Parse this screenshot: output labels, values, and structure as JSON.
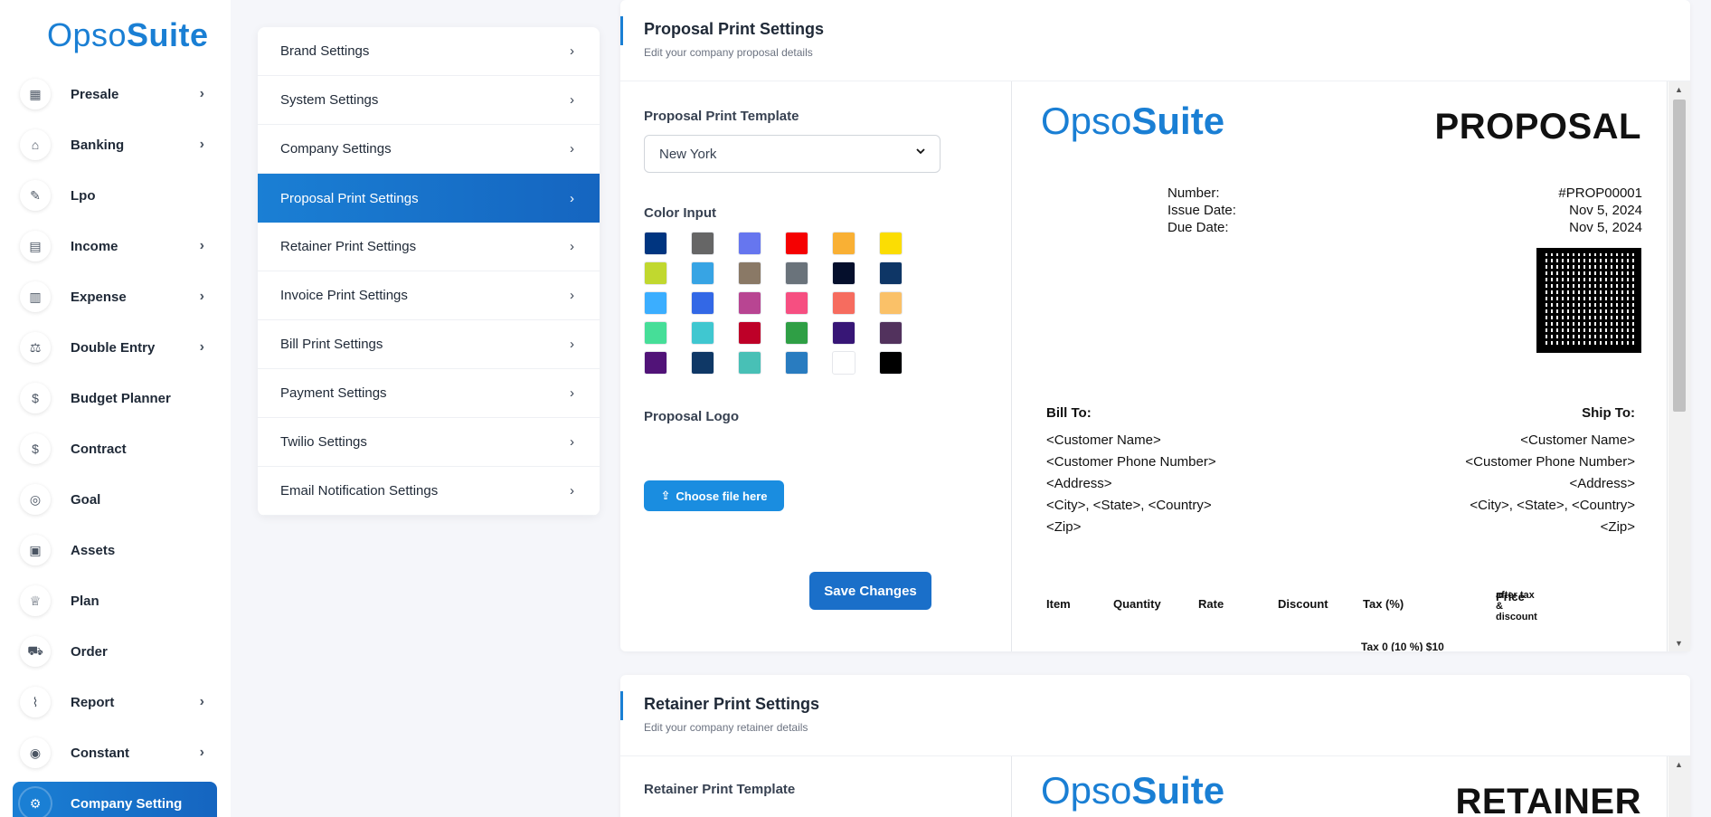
{
  "logo": {
    "prefix": "Opso",
    "suite": "Suite"
  },
  "nav": {
    "items": [
      {
        "label": "Presale",
        "icon": "building-icon",
        "glyph": "▦",
        "chevron": true
      },
      {
        "label": "Banking",
        "icon": "bank-icon",
        "glyph": "⌂",
        "chevron": true
      },
      {
        "label": "Lpo",
        "icon": "note-icon",
        "glyph": "✎",
        "chevron": false
      },
      {
        "label": "Income",
        "icon": "document-icon",
        "glyph": "▤",
        "chevron": true
      },
      {
        "label": "Expense",
        "icon": "receipt-icon",
        "glyph": "▥",
        "chevron": true
      },
      {
        "label": "Double Entry",
        "icon": "scale-icon",
        "glyph": "⚖",
        "chevron": true
      },
      {
        "label": "Budget Planner",
        "icon": "money-stack-icon",
        "glyph": "$",
        "chevron": false
      },
      {
        "label": "Contract",
        "icon": "coin-stack-icon",
        "glyph": "$",
        "chevron": false
      },
      {
        "label": "Goal",
        "icon": "target-icon",
        "glyph": "◎",
        "chevron": false
      },
      {
        "label": "Assets",
        "icon": "calculator-icon",
        "glyph": "▣",
        "chevron": false
      },
      {
        "label": "Plan",
        "icon": "trophy-icon",
        "glyph": "♕",
        "chevron": false
      },
      {
        "label": "Order",
        "icon": "cart-icon",
        "glyph": "⛟",
        "chevron": false
      },
      {
        "label": "Report",
        "icon": "chart-icon",
        "glyph": "⌇",
        "chevron": true
      },
      {
        "label": "Constant",
        "icon": "spiral-icon",
        "glyph": "◉",
        "chevron": true
      },
      {
        "label": "Company Setting",
        "icon": "settings-icon",
        "glyph": "⚙",
        "chevron": false,
        "active": true
      }
    ]
  },
  "settings_menu": [
    {
      "label": "Brand Settings"
    },
    {
      "label": "System Settings"
    },
    {
      "label": "Company Settings"
    },
    {
      "label": "Proposal Print Settings",
      "active": true
    },
    {
      "label": "Retainer Print Settings"
    },
    {
      "label": "Invoice Print Settings"
    },
    {
      "label": "Bill Print Settings"
    },
    {
      "label": "Payment Settings"
    },
    {
      "label": "Twilio Settings"
    },
    {
      "label": "Email Notification Settings"
    }
  ],
  "proposal": {
    "title": "Proposal Print Settings",
    "subtitle": "Edit your company proposal details",
    "template_label": "Proposal Print Template",
    "template_value": "New York",
    "color_label": "Color Input",
    "logo_label": "Proposal Logo",
    "upload_label": "Choose file here",
    "save_label": "Save Changes",
    "colors": [
      "#003580",
      "#666666",
      "#6676ef",
      "#f50102",
      "#f9b034",
      "#fbdd03",
      "#c1d82f",
      "#37a4e4",
      "#8a7966",
      "#6a737b",
      "#050f2c",
      "#0e3666",
      "#3baeff",
      "#3368e6",
      "#b84592",
      "#f64f81",
      "#f66c5f",
      "#fac168",
      "#46de98",
      "#40c7d0",
      "#be0028",
      "#2f9f45",
      "#371676",
      "#52325d",
      "#511378",
      "#0f3866",
      "#48c0b6",
      "#297cc0",
      "#ffffff",
      "#000000"
    ],
    "preview": {
      "heading": "PROPOSAL",
      "number_label": "Number:",
      "number": "#PROP00001",
      "issue_label": "Issue Date:",
      "issue": "Nov 5, 2024",
      "due_label": "Due Date:",
      "due": "Nov 5, 2024",
      "bill_to": "Bill To:",
      "ship_to": "Ship To:",
      "address": [
        "<Customer Name>",
        "<Customer Phone Number>",
        "<Address>",
        "<City>, <State>, <Country>",
        "<Zip>"
      ],
      "cols": {
        "item": "Item",
        "qty": "Quantity",
        "rate": "Rate",
        "discount": "Discount",
        "tax": "Tax (%)",
        "price": "Price",
        "price_sub": "after tax & discount"
      },
      "tax_line": "Tax 0 (10 %) $10"
    }
  },
  "retainer": {
    "title": "Retainer Print Settings",
    "subtitle": "Edit your company retainer details",
    "template_label": "Retainer Print Template",
    "heading": "RETAINER"
  }
}
